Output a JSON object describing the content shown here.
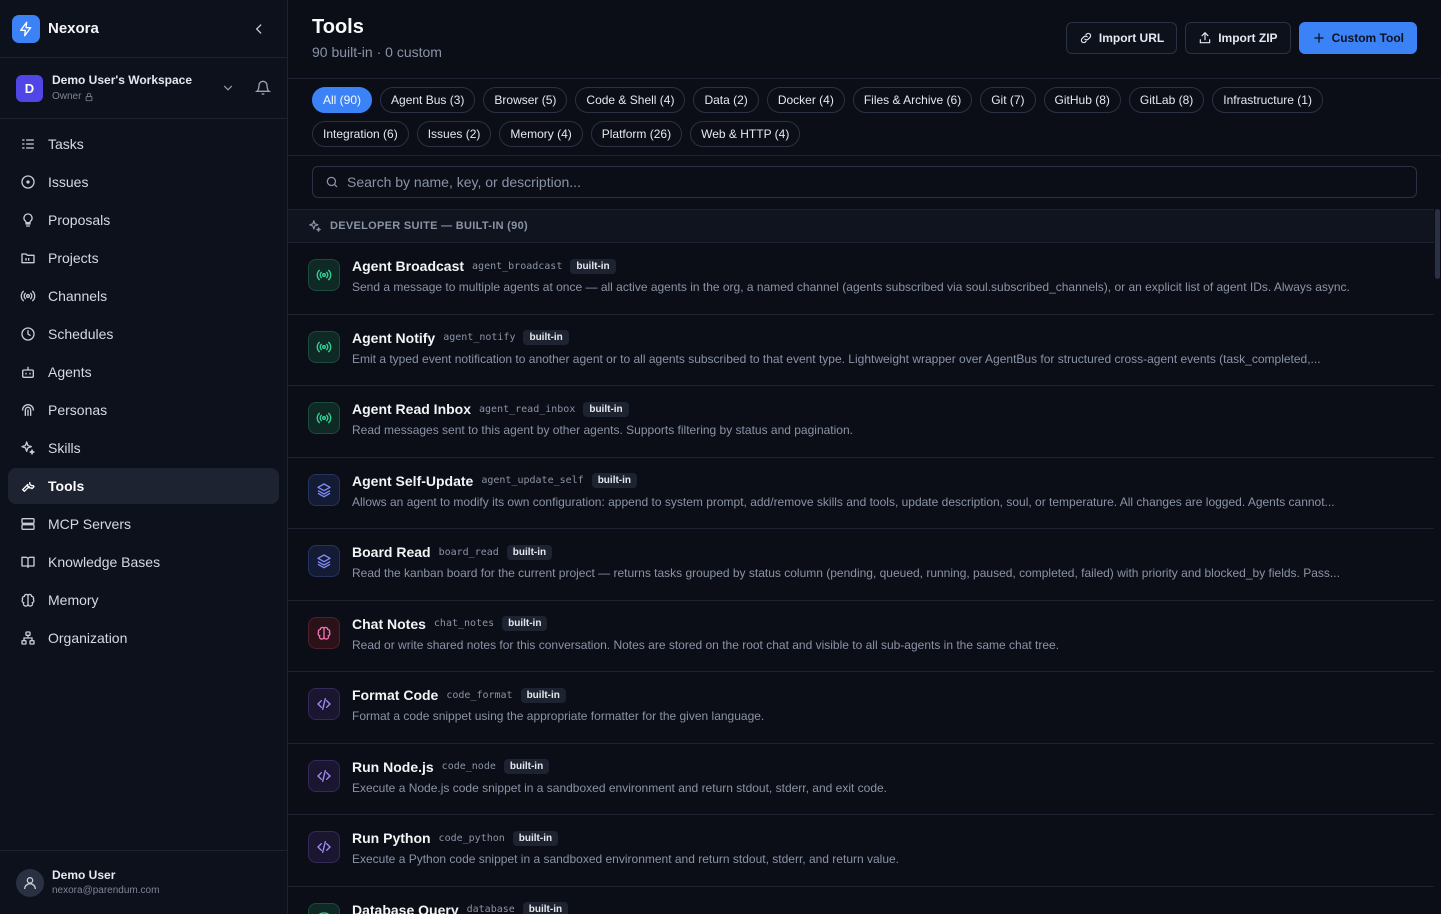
{
  "brand": {
    "name": "Nexora"
  },
  "workspace": {
    "avatar": "D",
    "name": "Demo User's Workspace",
    "role": "Owner"
  },
  "nav": [
    {
      "label": "Tasks",
      "icon": "tasks-icon",
      "active": false
    },
    {
      "label": "Issues",
      "icon": "issues-icon",
      "active": false
    },
    {
      "label": "Proposals",
      "icon": "lightbulb-icon",
      "active": false
    },
    {
      "label": "Projects",
      "icon": "folder-icon",
      "active": false
    },
    {
      "label": "Channels",
      "icon": "broadcast-icon",
      "active": false
    },
    {
      "label": "Schedules",
      "icon": "clock-icon",
      "active": false
    },
    {
      "label": "Agents",
      "icon": "bot-icon",
      "active": false
    },
    {
      "label": "Personas",
      "icon": "persona-icon",
      "active": false
    },
    {
      "label": "Skills",
      "icon": "sparkles-icon",
      "active": false
    },
    {
      "label": "Tools",
      "icon": "wrench-icon",
      "active": true
    },
    {
      "label": "MCP Servers",
      "icon": "server-icon",
      "active": false
    },
    {
      "label": "Knowledge Bases",
      "icon": "book-icon",
      "active": false
    },
    {
      "label": "Memory",
      "icon": "brain-icon",
      "active": false
    },
    {
      "label": "Organization",
      "icon": "org-icon",
      "active": false
    }
  ],
  "user": {
    "name": "Demo User",
    "email": "nexora@parendum.com"
  },
  "header": {
    "title": "Tools",
    "subtitle": "90 built-in · 0 custom",
    "import_url": "Import URL",
    "import_zip": "Import ZIP",
    "custom_tool": "Custom Tool"
  },
  "filters": [
    {
      "label": "All (90)",
      "active": true
    },
    {
      "label": "Agent Bus (3)"
    },
    {
      "label": "Browser (5)"
    },
    {
      "label": "Code & Shell (4)"
    },
    {
      "label": "Data (2)"
    },
    {
      "label": "Docker (4)"
    },
    {
      "label": "Files & Archive (6)"
    },
    {
      "label": "Git (7)"
    },
    {
      "label": "GitHub (8)"
    },
    {
      "label": "GitLab (8)"
    },
    {
      "label": "Infrastructure (1)"
    },
    {
      "label": "Integration (6)"
    },
    {
      "label": "Issues (2)"
    },
    {
      "label": "Memory (4)"
    },
    {
      "label": "Platform (26)"
    },
    {
      "label": "Web & HTTP (4)"
    }
  ],
  "search": {
    "placeholder": "Search by name, key, or description..."
  },
  "section": {
    "label": "DEVELOPER SUITE — BUILT-IN (90)"
  },
  "tools": [
    {
      "name": "Agent Broadcast",
      "key": "agent_broadcast",
      "badge": "built-in",
      "icon": "broadcast-icon",
      "color": "green",
      "desc": "Send a message to multiple agents at once — all active agents in the org, a named channel (agents subscribed via soul.subscribed_channels), or an explicit list of agent IDs. Always async."
    },
    {
      "name": "Agent Notify",
      "key": "agent_notify",
      "badge": "built-in",
      "icon": "broadcast-icon",
      "color": "green",
      "desc": "Emit a typed event notification to another agent or to all agents subscribed to that event type. Lightweight wrapper over AgentBus for structured cross-agent events (task_completed,..."
    },
    {
      "name": "Agent Read Inbox",
      "key": "agent_read_inbox",
      "badge": "built-in",
      "icon": "broadcast-icon",
      "color": "green",
      "desc": "Read messages sent to this agent by other agents. Supports filtering by status and pagination."
    },
    {
      "name": "Agent Self-Update",
      "key": "agent_update_self",
      "badge": "built-in",
      "icon": "layers-icon",
      "color": "blue",
      "desc": "Allows an agent to modify its own configuration: append to system prompt, add/remove skills and tools, update description, soul, or temperature. All changes are logged. Agents cannot..."
    },
    {
      "name": "Board Read",
      "key": "board_read",
      "badge": "built-in",
      "icon": "layers-icon",
      "color": "blue",
      "desc": "Read the kanban board for the current project — returns tasks grouped by status column (pending, queued, running, paused, completed, failed) with priority and blocked_by fields. Pass..."
    },
    {
      "name": "Chat Notes",
      "key": "chat_notes",
      "badge": "built-in",
      "icon": "brain-icon",
      "color": "red",
      "desc": "Read or write shared notes for this conversation. Notes are stored on the root chat and visible to all sub-agents in the same chat tree."
    },
    {
      "name": "Format Code",
      "key": "code_format",
      "badge": "built-in",
      "icon": "code-icon",
      "color": "purple",
      "desc": "Format a code snippet using the appropriate formatter for the given language."
    },
    {
      "name": "Run Node.js",
      "key": "code_node",
      "badge": "built-in",
      "icon": "code-icon",
      "color": "purple",
      "desc": "Execute a Node.js code snippet in a sandboxed environment and return stdout, stderr, and exit code."
    },
    {
      "name": "Run Python",
      "key": "code_python",
      "badge": "built-in",
      "icon": "code-icon",
      "color": "purple",
      "desc": "Execute a Python code snippet in a sandboxed environment and return stdout, stderr, and return value."
    },
    {
      "name": "Database Query",
      "key": "database",
      "badge": "built-in",
      "icon": "database-icon",
      "color": "green",
      "desc": ""
    }
  ]
}
